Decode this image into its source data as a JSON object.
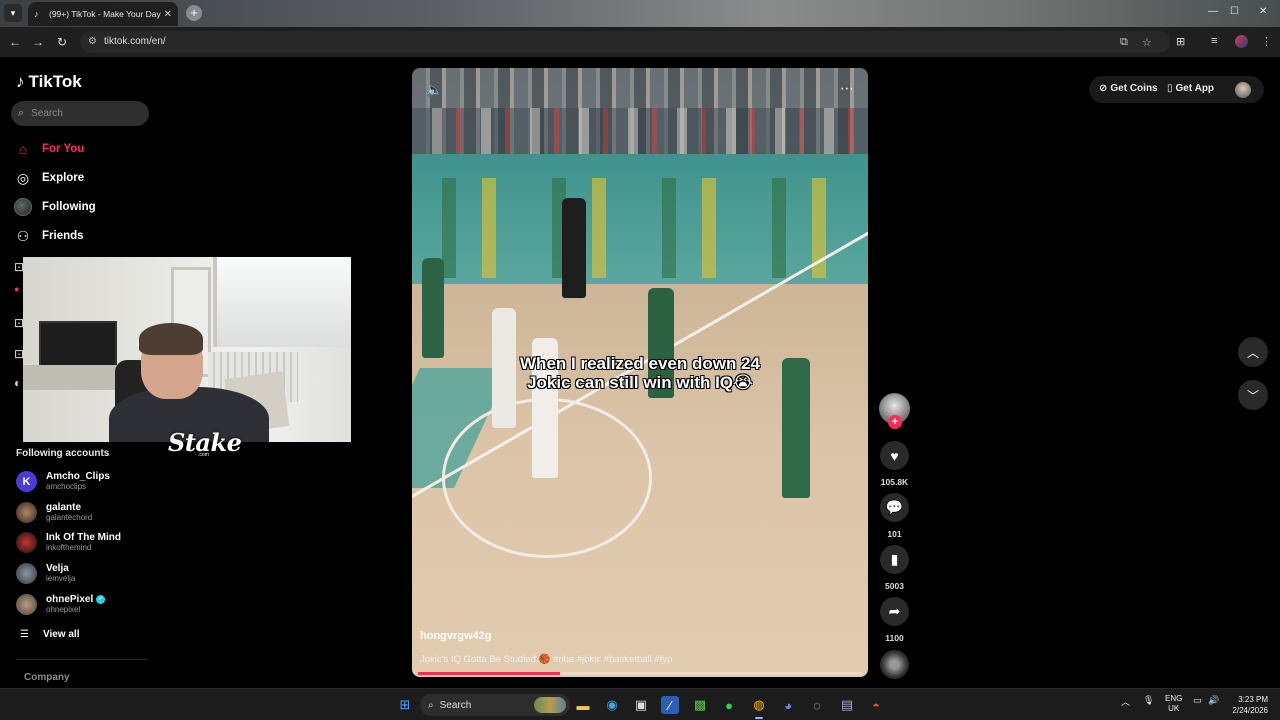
{
  "browser": {
    "tab_title": "(99+) TikTok - Make Your Day",
    "url": "tiktok.com/en/"
  },
  "tiktok": {
    "logo_text": "TikTok",
    "search_placeholder": "Search",
    "nav": [
      {
        "label": "For You",
        "icon": "home-icon",
        "active": true
      },
      {
        "label": "Explore",
        "icon": "compass-icon",
        "active": false
      },
      {
        "label": "Following",
        "icon": "following-avatar",
        "active": false
      },
      {
        "label": "Friends",
        "icon": "friends-icon",
        "active": false
      }
    ],
    "following_title": "Following accounts",
    "accounts": [
      {
        "name": "Amcho_Clips",
        "handle": "amchoclips",
        "verified": false
      },
      {
        "name": "galante",
        "handle": "galantechord",
        "verified": false
      },
      {
        "name": "Ink Of The Mind",
        "handle": "inkofthemind",
        "verified": false
      },
      {
        "name": "Velja",
        "handle": "iemvelja",
        "verified": false
      },
      {
        "name": "ohnePixel",
        "handle": "ohnepixel",
        "verified": true
      }
    ],
    "view_all": "View all",
    "company": "Company",
    "top_right": {
      "get_coins": "Get Coins",
      "get_app": "Get App"
    }
  },
  "webcam_overlay": {
    "brand": "Stake",
    "brand_sub": ".com"
  },
  "video": {
    "caption_line1": "When I realized even down 24",
    "caption_line2": "Jokic can still win with IQ😭",
    "author": "hongvrgw42g",
    "description": "Jokic's IQ Gotta Be Studied.🏀 #nba #jokic #basketball #fyp",
    "progress": 0.32,
    "likes": "105.8K",
    "comments": "101",
    "saves": "5003",
    "shares": "1100",
    "follow_symbol": "+"
  },
  "taskbar": {
    "search_label": "Search",
    "lang_line1": "ENG",
    "lang_line2": "UK",
    "time": "3:23 PM",
    "date": "2/24/2026"
  },
  "colors": {
    "accent": "#fe2c55",
    "background": "#000000"
  }
}
